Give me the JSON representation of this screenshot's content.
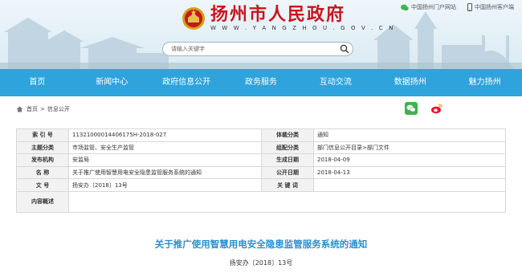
{
  "header": {
    "site_title": "扬州市人民政府",
    "site_url": "W W W . Y A N G Z H O U . G O V . C N",
    "links": [
      {
        "label": "中国扬州门户网站",
        "icon": "wechat-icon"
      },
      {
        "label": "中国扬州客户端",
        "icon": "mobile-icon"
      }
    ],
    "search_placeholder": "请输入关键字"
  },
  "nav": {
    "items": [
      "首页",
      "新闻中心",
      "政府信息公开",
      "政务服务",
      "互动交流",
      "数据扬州",
      "魅力扬州"
    ]
  },
  "breadcrumb": {
    "home": "首页",
    "separator": ">",
    "current": "信息公开"
  },
  "meta": {
    "rows": [
      {
        "label1": "索 引 号",
        "value1": "11321000014406175H-2018-027",
        "label2": "体裁分类",
        "value2": "通知"
      },
      {
        "label1": "主题分类",
        "value1": "市场监管、安全生产监管",
        "label2": "组配分类",
        "value2": "部门信息公开目录>部门文件"
      },
      {
        "label1": "发布机构",
        "value1": "安监局",
        "label2": "生成日期",
        "value2": "2018-04-09"
      },
      {
        "label1": "名    称",
        "value1": "关于推广使用智慧用电安全隐患监管服务系统的通知",
        "label2": "公开日期",
        "value2": "2018-04-13"
      },
      {
        "label1": "文    号",
        "value1": "扬安办〔2018〕13号",
        "label2": "关 键 词",
        "value2": ""
      }
    ],
    "summary_label": "内容概述",
    "summary_value": ""
  },
  "article": {
    "title": "关于推广使用智慧用电安全隐患监管服务系统的通知",
    "doc_number": "扬安办〔2018〕13号"
  },
  "colors": {
    "nav_bg": "#2ea3dc",
    "title_red": "#c8161d",
    "article_title_blue": "#2a8fd0"
  }
}
